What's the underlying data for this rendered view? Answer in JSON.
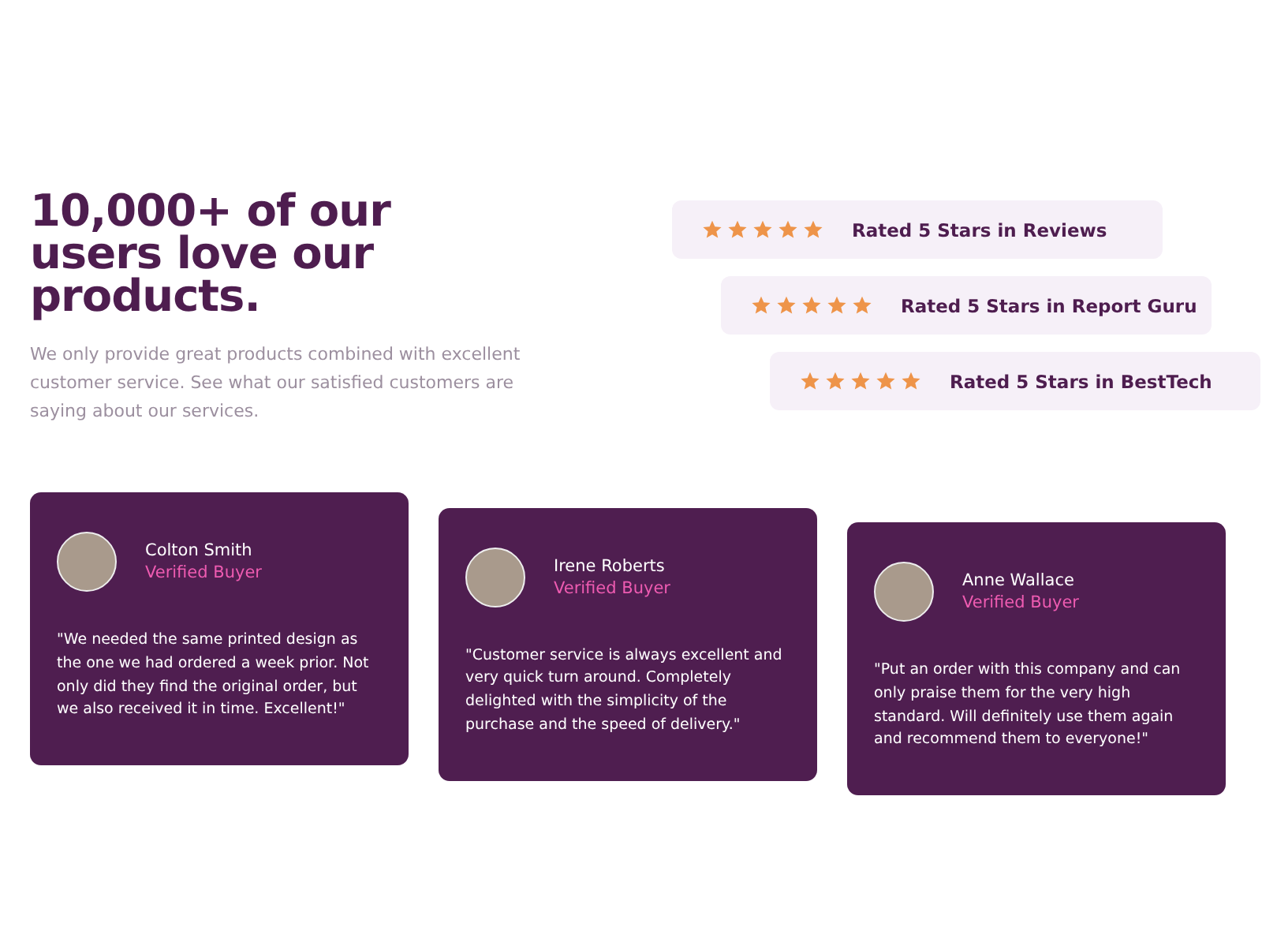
{
  "heading": "10,000+ of our users love our products.",
  "intro": "We only provide great products combined with excellent customer service. See what our satisfied customers are saying about our services.",
  "ratings": [
    {
      "stars": 5,
      "label": "Rated 5 Stars in Reviews"
    },
    {
      "stars": 5,
      "label": "Rated 5 Stars in Report Guru"
    },
    {
      "stars": 5,
      "label": "Rated 5 Stars in BestTech"
    }
  ],
  "testimonials": [
    {
      "name": "Colton Smith",
      "badge": "Verified Buyer",
      "quote": "\"We needed the same printed design as the one we had ordered a week prior. Not only did they find the original order, but we also received it in time. Excellent!\""
    },
    {
      "name": "Irene Roberts",
      "badge": "Verified Buyer",
      "quote": "\"Customer service is always excellent and very quick turn around. Completely delighted with the simplicity of the purchase and the speed of delivery.\""
    },
    {
      "name": "Anne Wallace",
      "badge": "Verified Buyer",
      "quote": "\"Put an order with this company and can only praise them for the very high standard. Will definitely use them again and recommend them to everyone!\""
    }
  ]
}
